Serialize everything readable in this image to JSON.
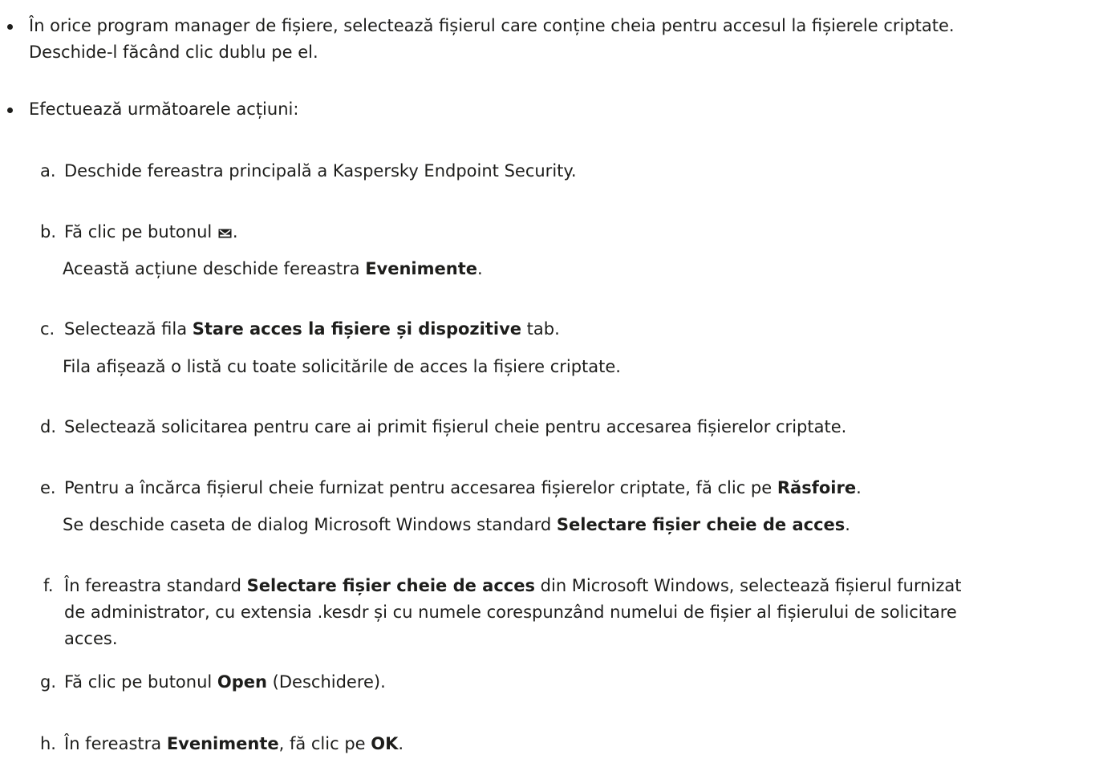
{
  "bullets": [
    {
      "line1": "În orice program manager de fișiere, selectează fișierul care conține cheia pentru accesul la fișierele criptate.",
      "line2": "Deschide-l făcând clic dublu pe el."
    },
    {
      "line1": "Efectuează următoarele acțiuni:"
    }
  ],
  "steps": {
    "a": {
      "marker": "a.",
      "text": "Deschide fereastra principală a Kaspersky Endpoint Security."
    },
    "b": {
      "marker": "b.",
      "pre": "Fă clic pe butonul",
      "icon": "mail-icon",
      "post": ".",
      "sub_pre": "Această acțiune deschide fereastra ",
      "sub_bold": "Evenimente",
      "sub_post": "."
    },
    "c": {
      "marker": "c.",
      "pre": "Selectează fila ",
      "bold": "Stare acces la fișiere și dispozitive",
      "post": " tab.",
      "sub": "Fila afișează o listă cu toate solicitările de acces la fișiere criptate."
    },
    "d": {
      "marker": "d.",
      "text": "Selectează solicitarea pentru care ai primit fișierul cheie pentru accesarea fișierelor criptate."
    },
    "e": {
      "marker": "e.",
      "pre": "Pentru a încărca fișierul cheie furnizat pentru accesarea fișierelor criptate, fă clic pe ",
      "bold": "Răsfoire",
      "post": ".",
      "sub_pre": "Se deschide caseta de dialog Microsoft Windows standard ",
      "sub_bold": "Selectare fișier cheie de acces",
      "sub_post": "."
    },
    "f": {
      "marker": "f.",
      "pre": "În fereastra standard ",
      "bold": "Selectare fișier cheie de acces",
      "post": " din Microsoft Windows, selectează fișierul furnizat",
      "line2": "de administrator, cu extensia .kesdr și cu numele corespunzând numelui de fișier al fișierului de solicitare",
      "line3": "acces."
    },
    "g": {
      "marker": "g.",
      "pre": "Fă clic pe butonul ",
      "bold": "Open",
      "post": " (Deschidere)."
    },
    "h": {
      "marker": "h.",
      "pre": "În fereastra ",
      "bold": "Evenimente",
      "mid": ", fă clic pe ",
      "bold2": "OK",
      "post": "."
    }
  }
}
